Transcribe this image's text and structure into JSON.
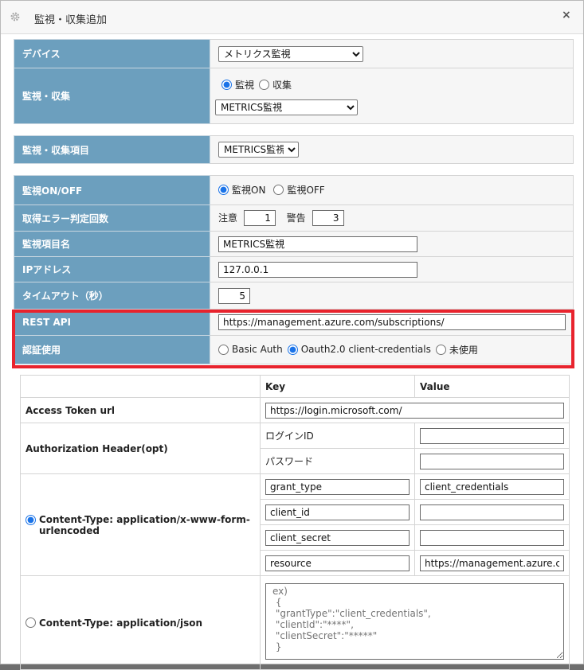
{
  "dialog": {
    "title": "監視・収集追加",
    "close_label": "×"
  },
  "device": {
    "label": "デバイス",
    "selected": "メトリクス監視"
  },
  "monitor_collect": {
    "label": "監視・収集",
    "radio_monitor": "監視",
    "radio_collect": "収集",
    "selected_monitor": "monitor",
    "type_selected": "METRICS監視"
  },
  "monitor_item": {
    "label": "監視・収集項目",
    "selected": "METRICS監視"
  },
  "monitor_onoff": {
    "label": "監視ON/OFF",
    "on_label": "監視ON",
    "off_label": "監視OFF",
    "selected": "on"
  },
  "error_count": {
    "label": "取得エラー判定回数",
    "caution_label": "注意",
    "caution_value": "1",
    "warning_label": "警告",
    "warning_value": "3"
  },
  "item_name": {
    "label": "監視項目名",
    "value": "METRICS監視"
  },
  "ip_address": {
    "label": "IPアドレス",
    "value": "127.0.0.1"
  },
  "timeout": {
    "label": "タイムアウト（秒）",
    "value": "5"
  },
  "rest_api": {
    "label": "REST API",
    "value": "https://management.azure.com/subscriptions/"
  },
  "auth_use": {
    "label": "認証使用",
    "basic_label": "Basic Auth",
    "oauth_label": "Oauth2.0 client-credentials",
    "none_label": "未使用",
    "selected": "oauth"
  },
  "auth_table": {
    "key_header": "Key",
    "value_header": "Value",
    "access_token_label": "Access Token url",
    "access_token_value": "https://login.microsoft.com/",
    "auth_header_label": "Authorization Header(opt)",
    "login_id_label": "ログインID",
    "login_id_value": "",
    "password_label": "パスワード",
    "password_value": "",
    "form_content_type_label": "Content-Type: application/x-www-form-urlencoded",
    "form_rows": [
      {
        "key": "grant_type",
        "value": "client_credentials"
      },
      {
        "key": "client_id",
        "value": ""
      },
      {
        "key": "client_secret",
        "value": ""
      },
      {
        "key": "resource",
        "value": "https://management.azure.com/"
      }
    ],
    "json_content_type_label": "Content-Type: application/json",
    "json_placeholder": "ex)\n {\n \"grantType\":\"client_credentials\",\n \"clientId\":\"****\",\n \"clientSecret\":\"*****\"\n }",
    "selected_content_type": "form"
  },
  "colors": {
    "label_bg": "#6c9fbe",
    "highlight_border": "#e8232d",
    "radio_accent": "#1a73e8"
  },
  "icons": {
    "title_icon": "gear-icon",
    "close_icon": "close-icon"
  }
}
